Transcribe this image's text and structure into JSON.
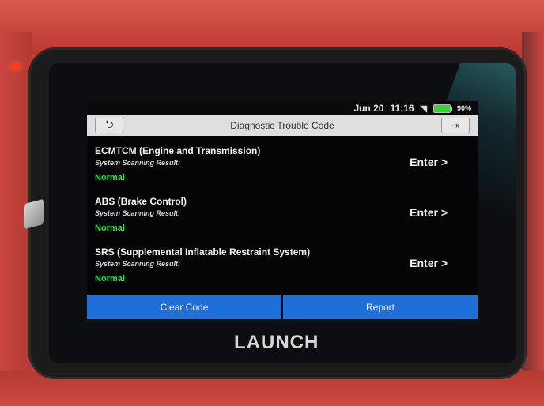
{
  "status": {
    "date": "Jun 20",
    "time": "11:16",
    "battery": "90%"
  },
  "header": {
    "title": "Diagnostic Trouble Code",
    "back_icon": "back-arrow-icon",
    "exit_icon": "exit-icon"
  },
  "systems": [
    {
      "name": "ECMTCM (Engine and Transmission)",
      "label": "System Scanning Result:",
      "status": "Normal",
      "action": "Enter >"
    },
    {
      "name": "ABS (Brake Control)",
      "label": "System Scanning Result:",
      "status": "Normal",
      "action": "Enter >"
    },
    {
      "name": "SRS (Supplemental Inflatable Restraint System)",
      "label": "System Scanning Result:",
      "status": "Normal",
      "action": "Enter >"
    }
  ],
  "footer": {
    "clear_label": "Clear Code",
    "report_label": "Report"
  },
  "brand": "LAUNCH",
  "colors": {
    "status_ok": "#2ee64a",
    "button_blue": "#1e6fd8",
    "device_red": "#c9463f"
  }
}
